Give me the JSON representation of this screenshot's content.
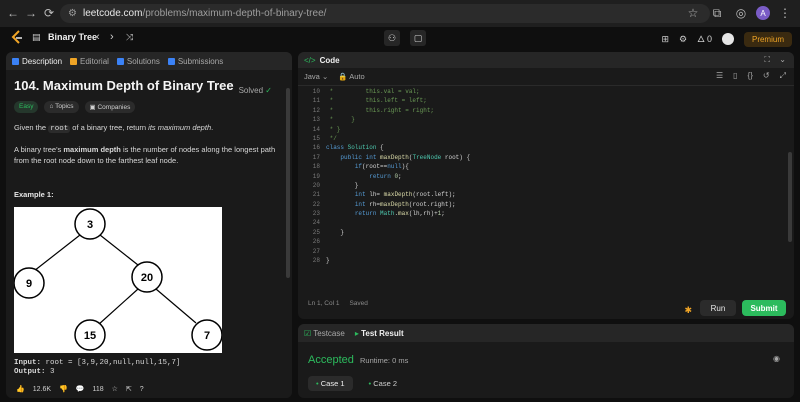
{
  "browser": {
    "url_host": "leetcode.com",
    "url_path": "/problems/maximum-depth-of-binary-tree/",
    "avatar_letter": "A"
  },
  "appbar": {
    "problem_list_title": "Binary Tree",
    "streak_count": "0",
    "premium_label": "Premium"
  },
  "left_tabs": [
    {
      "label": "Description",
      "active": true
    },
    {
      "label": "Editorial",
      "active": false
    },
    {
      "label": "Solutions",
      "active": false
    },
    {
      "label": "Submissions",
      "active": false
    }
  ],
  "problem": {
    "title": "104. Maximum Depth of Binary Tree",
    "status": "Solved",
    "chips": [
      "Easy",
      "Topics",
      "Companies"
    ],
    "desc_1_pre": "Given the ",
    "desc_1_code": "root",
    "desc_1_mid": " of a binary tree, return ",
    "desc_1_em": "its maximum depth",
    "desc_1_end": ".",
    "desc_2_pre": "A binary tree's ",
    "desc_2_bold": "maximum depth",
    "desc_2_end": " is the number of nodes along the longest path from the root node down to the farthest leaf node.",
    "example_title": "Example 1:",
    "tree_nodes": [
      "3",
      "9",
      "20",
      "15",
      "7"
    ],
    "input_label": "Input:",
    "input_value": "root = [3,9,20,null,null,15,7]",
    "output_label": "Output:",
    "output_value": "3"
  },
  "footer": {
    "likes": "12.6K",
    "comments": "118"
  },
  "editor": {
    "title": "Code",
    "language": "Java",
    "mode": "Auto",
    "line_numbers": [
      "10",
      "11",
      "12",
      "13",
      "14",
      "15",
      "16",
      "17",
      "18",
      "19",
      "20",
      "21",
      "22",
      "23",
      "24",
      "25",
      "26",
      "27",
      "28"
    ],
    "code_lines": [
      " *         this.val = val;",
      " *         this.left = left;",
      " *         this.right = right;",
      " *     }",
      " * }",
      " */",
      "class Solution {",
      "    public int maxDepth(TreeNode root) {",
      "        if(root==null){",
      "            return 0;",
      "        }",
      "        int lh= maxDepth(root.left);",
      "        int rh=maxDepth(root.right);",
      "        return Math.max(lh,rh)+1;",
      "",
      "    }",
      "",
      "",
      "}"
    ],
    "status_position": "Ln 1, Col 1",
    "status_saved": "Saved",
    "run_label": "Run",
    "submit_label": "Submit"
  },
  "result": {
    "tabs": [
      "Testcase",
      "Test Result"
    ],
    "verdict": "Accepted",
    "runtime": "Runtime: 0 ms",
    "cases": [
      "Case 1",
      "Case 2"
    ]
  },
  "colors": {
    "accent_green": "#2cbb5d",
    "premium_orange": "#f0a526",
    "bg_dark": "#0f0f0f",
    "panel": "#1a1a1a"
  }
}
